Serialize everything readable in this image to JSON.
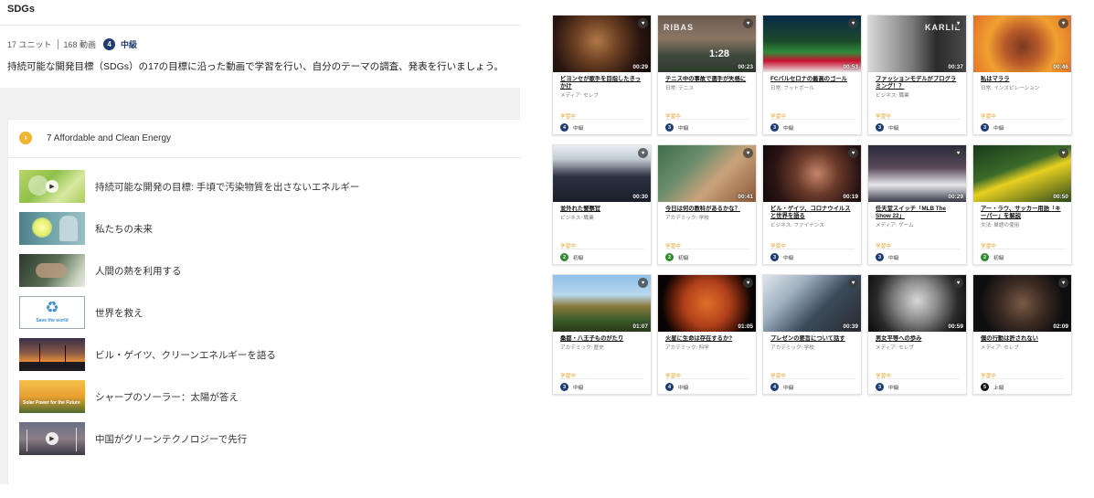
{
  "course": {
    "title": "SDGs",
    "units": "17 ユニット",
    "videos": "168 動画",
    "level_num": "4",
    "level_label": "中級",
    "description": "持続可能な開発目標（SDGs）の17の目標に沿った動画で学習を行い、自分のテーマの調査、発表を行いましょう。"
  },
  "unit": {
    "title": "7 Affordable and Clean Energy",
    "lessons": [
      {
        "label": "持続可能な開発の目標: 手頃で汚染物質を出さないエネルギー",
        "thumb_icon": "play-icon"
      },
      {
        "label": "私たちの未来",
        "thumb_icon": "lightbulb-image"
      },
      {
        "label": "人間の熱を利用する",
        "thumb_icon": "hand-image"
      },
      {
        "label": "世界を救え",
        "thumb_icon": "recycle-logo-image",
        "logo_text": "Save the world"
      },
      {
        "label": "ビル・ゲイツ、クリーンエネルギーを語る",
        "thumb_icon": "sunset-power-lines-image"
      },
      {
        "label": "シャープのソーラー：太陽が答え",
        "thumb_icon": "solar-image",
        "overlay_text": "Solar Power for the Future"
      },
      {
        "label": "中国がグリーンテクノロジーで先行",
        "thumb_icon": "play-icon"
      }
    ]
  },
  "videos": [
    {
      "title": "ビヨンセが歌手を目指したきっかけ",
      "category": "メディア: セレブ",
      "duration": "00:29",
      "status": "学習中",
      "level_num": "4",
      "level": "中級"
    },
    {
      "title": "テニス中の事故で選手が失格に",
      "category": "日常: テニス",
      "duration": "00:23",
      "status": "学習中",
      "level_num": "3",
      "level": "中級",
      "thumb_text": "RIBAS",
      "score_text": "1:28"
    },
    {
      "title": "FCバルセロナの最高のゴール",
      "category": "日常: フットボール",
      "duration": "00:53",
      "status": "学習中",
      "level_num": "3",
      "level": "中級"
    },
    {
      "title": "ファッションモデルがプログラミング！？",
      "category": "ビジネス: 職業",
      "duration": "00:37",
      "status": "学習中",
      "level_num": "3",
      "level": "中級",
      "thumb_text": "KARLIE"
    },
    {
      "title": "私はマララ",
      "category": "日常: インスピレーション",
      "duration": "00:46",
      "status": "学習中",
      "level_num": "3",
      "level": "中級"
    },
    {
      "title": "並外れた警察官",
      "category": "ビジネス: 職業",
      "duration": "00:30",
      "status": "学習中",
      "level_num": "2",
      "level": "初級"
    },
    {
      "title": "今日は何の教科があるかな？",
      "category": "アカデミック: 学校",
      "duration": "00:41",
      "status": "学習中",
      "level_num": "2",
      "level": "初級"
    },
    {
      "title": "ビル・ゲイツ、コロナウイルスと世界を語る",
      "category": "ビジネス: ファイナンス",
      "duration": "00:19",
      "status": "学習中",
      "level_num": "3",
      "level": "中級"
    },
    {
      "title": "任天堂スイッチ「MLB The Show 22」",
      "category": "メディア: ゲーム",
      "duration": "00:29",
      "status": "学習中",
      "level_num": "3",
      "level": "中級"
    },
    {
      "title": "アー・ラウ、サッカー用語「キーパー」を解説",
      "category": "文法: 単語の使用",
      "duration": "00:50",
      "status": "学習中",
      "level_num": "2",
      "level": "初級"
    },
    {
      "title": "桑都・八王子ものがたり",
      "category": "アカデミック: 歴史",
      "duration": "01:07",
      "status": "学習中",
      "level_num": "3",
      "level": "中級"
    },
    {
      "title": "火星に生命は存在するか?",
      "category": "アカデミック: 科学",
      "duration": "01:05",
      "status": "学習中",
      "level_num": "4",
      "level": "中級"
    },
    {
      "title": "プレゼンの要旨について話す",
      "category": "アカデミック: 学校",
      "duration": "00:39",
      "status": "学習中",
      "level_num": "4",
      "level": "中級"
    },
    {
      "title": "男女平等への歩み",
      "category": "メディア: セレブ",
      "duration": "00:59",
      "status": "学習中",
      "level_num": "3",
      "level": "中級"
    },
    {
      "title": "僕の行動は許されない",
      "category": "メディア: セレブ",
      "duration": "02:09",
      "status": "学習中",
      "level_num": "5",
      "level": "上級"
    }
  ],
  "colors": {
    "level_2": "#2e8b2e",
    "level_3": "#1e3c72",
    "level_4": "#1e3c72",
    "level_5": "#111111",
    "status": "#e0a12c",
    "accent": "#f0b430"
  }
}
